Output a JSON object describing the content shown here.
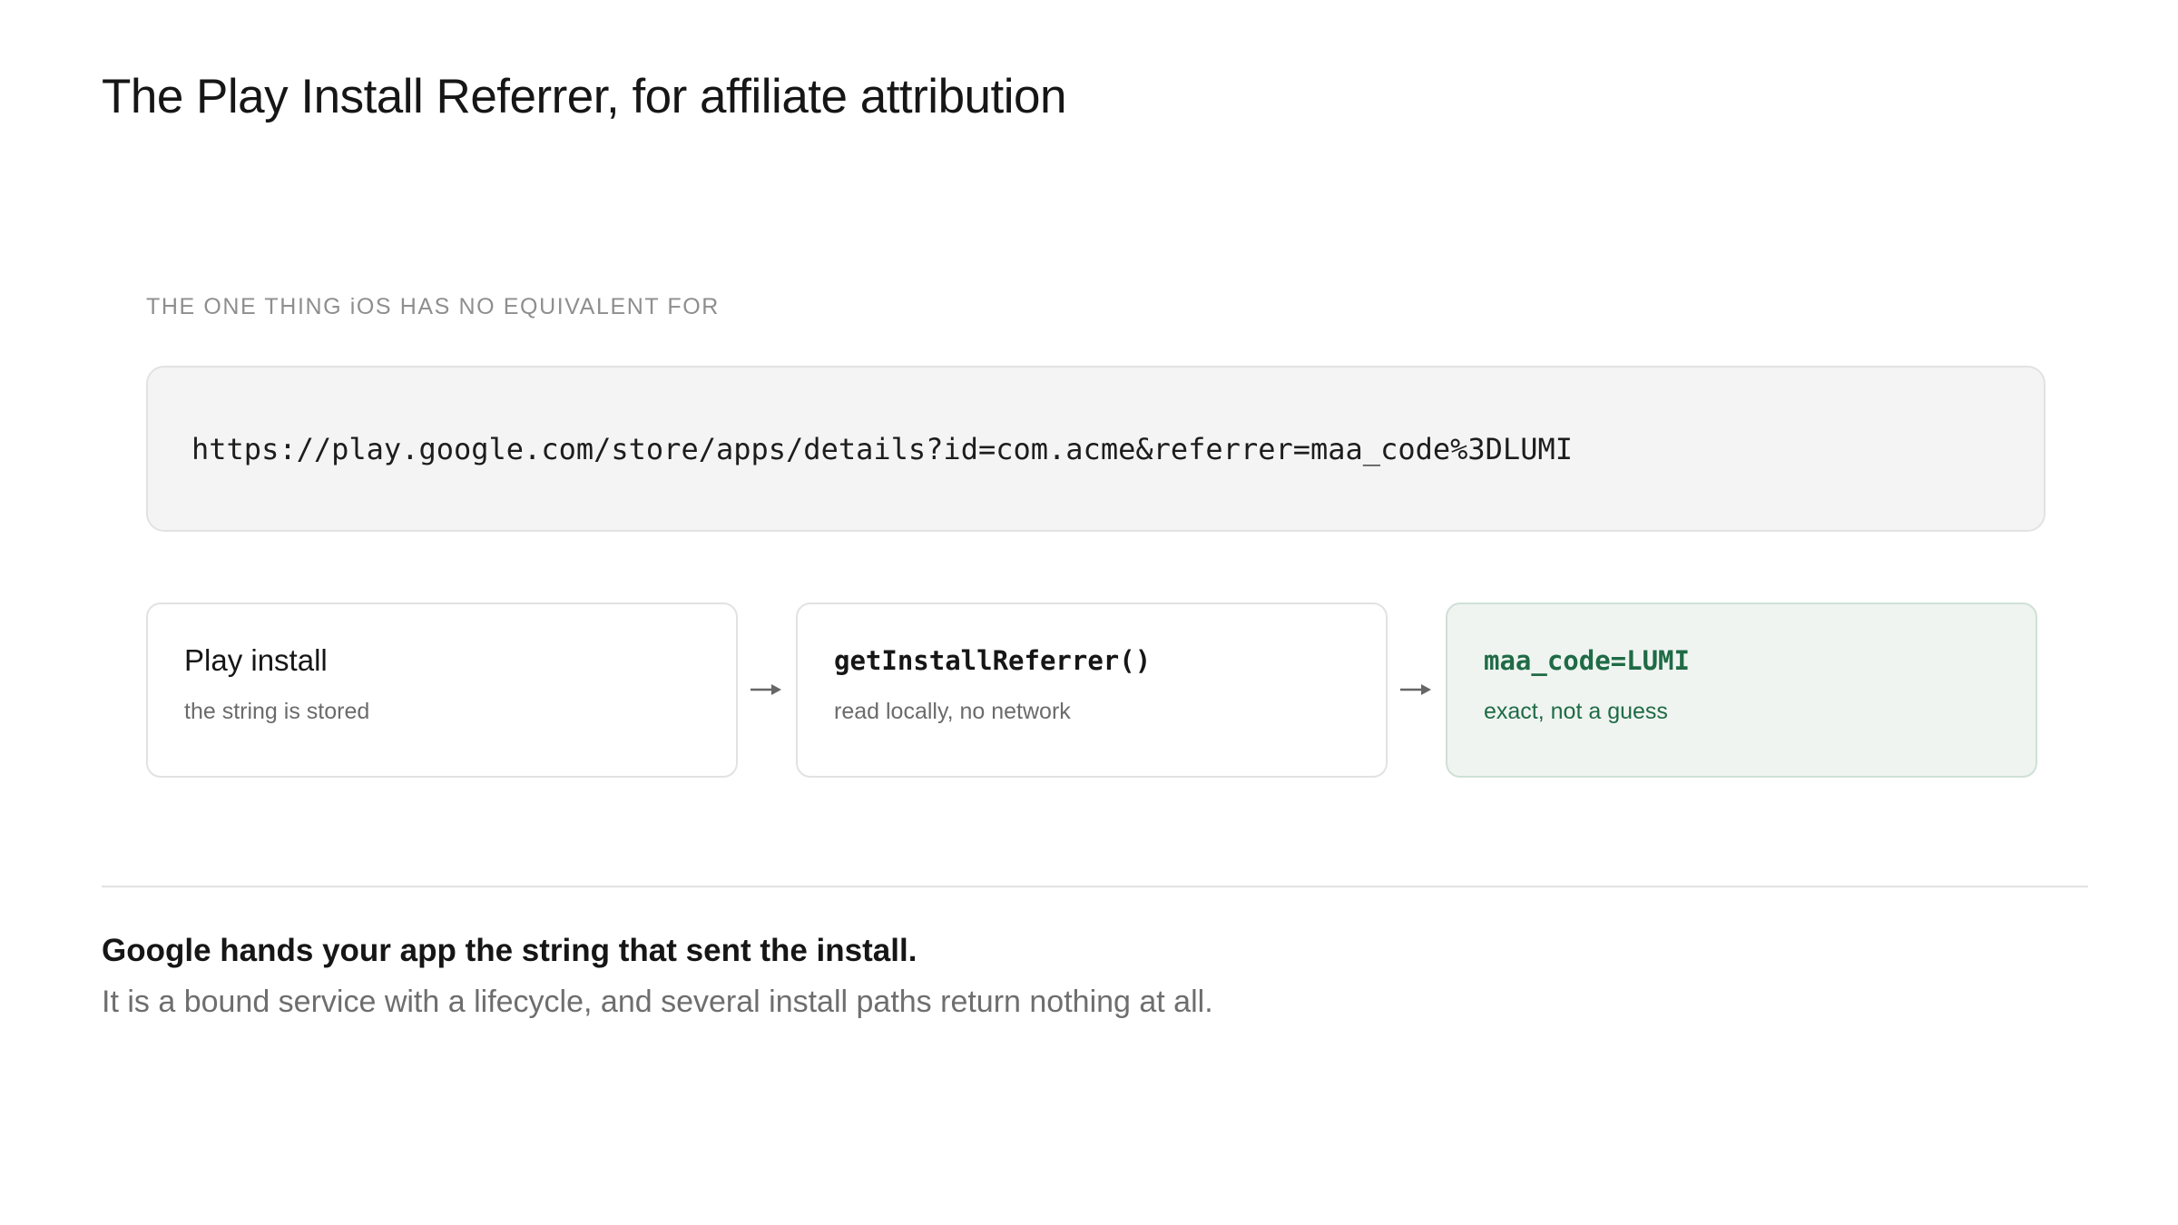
{
  "page": {
    "title": "The Play Install Referrer, for affiliate attribution",
    "eyebrow": "THE ONE THING iOS HAS NO EQUIVALENT FOR",
    "url": "https://play.google.com/store/apps/details?id=com.acme&referrer=maa_code%3DLUMI"
  },
  "steps": [
    {
      "title": "Play install",
      "subtitle": "the string is stored"
    },
    {
      "title": "getInstallReferrer()",
      "subtitle": "read locally, no network"
    },
    {
      "title": "maa_code=LUMI",
      "subtitle": "exact, not a guess"
    }
  ],
  "icons": [
    "arrow-right-icon",
    "arrow-right-icon"
  ],
  "colors": {
    "accent_green": "#1f6b45",
    "highlight_bg": "#eff4f1",
    "url_box_bg": "#f4f4f4"
  },
  "footer": {
    "headline": "Google hands your app the string that sent the install.",
    "detail": "It is a bound service with a lifecycle, and several install paths return nothing at all."
  }
}
